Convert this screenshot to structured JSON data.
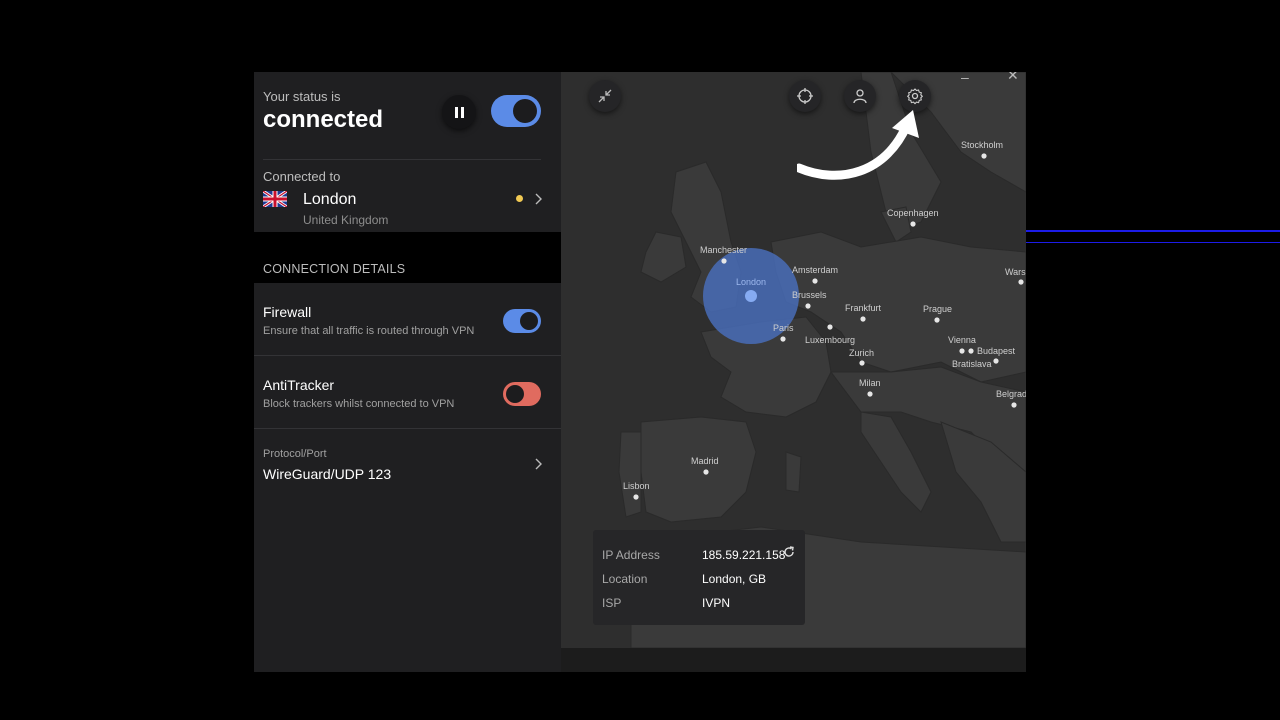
{
  "status": {
    "label": "Your status is",
    "state": "connected"
  },
  "connection": {
    "label": "Connected to",
    "city": "London",
    "country": "United Kingdom"
  },
  "details": {
    "title": "CONNECTION DETAILS",
    "firewall": {
      "title": "Firewall",
      "desc": "Ensure that all traffic is routed through VPN",
      "enabled": true
    },
    "antitracker": {
      "title": "AntiTracker",
      "desc": "Block trackers whilst connected to VPN",
      "enabled": false
    },
    "protocol": {
      "label": "Protocol/Port",
      "value": "WireGuard/UDP 123"
    }
  },
  "map": {
    "cities": [
      {
        "name": "Stockholm"
      },
      {
        "name": "Copenhagen"
      },
      {
        "name": "Manchester"
      },
      {
        "name": "London"
      },
      {
        "name": "Amsterdam"
      },
      {
        "name": "Brussels"
      },
      {
        "name": "Frankfurt"
      },
      {
        "name": "Prague"
      },
      {
        "name": "Warsaw"
      },
      {
        "name": "Paris"
      },
      {
        "name": "Luxembourg"
      },
      {
        "name": "Vienna"
      },
      {
        "name": "Budapest"
      },
      {
        "name": "Bratislava"
      },
      {
        "name": "Zurich"
      },
      {
        "name": "Milan"
      },
      {
        "name": "Belgrade"
      },
      {
        "name": "Madrid"
      },
      {
        "name": "Lisbon"
      }
    ]
  },
  "info": {
    "ip_label": "IP Address",
    "ip_value": "185.59.221.158",
    "location_label": "Location",
    "location_value": "London, GB",
    "isp_label": "ISP",
    "isp_value": "IVPN"
  },
  "colors": {
    "accent": "#5b8be7",
    "danger": "#e06b5f",
    "status_dot": "#f1c953",
    "background": "#000000"
  },
  "icons": [
    "pause-icon",
    "uk-flag-icon",
    "chevron-right-icon",
    "minimize-map-icon",
    "crosshair-icon",
    "user-icon",
    "gear-icon",
    "refresh-icon",
    "arrow-icon"
  ]
}
